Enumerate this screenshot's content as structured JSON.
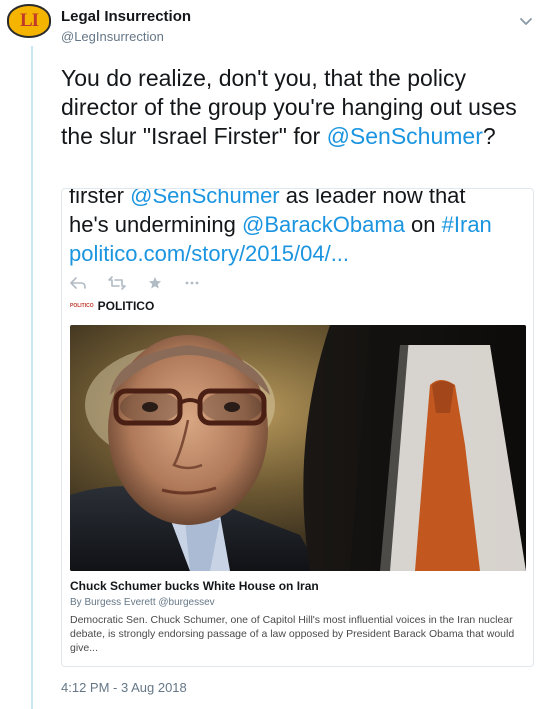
{
  "account": {
    "logo_text": "LI",
    "name": "Legal Insurrection",
    "handle": "@LegInsurrection"
  },
  "tweet": {
    "text_part1": "You do realize, don't you, that the policy director of the group you're hanging out uses the slur \"Israel Firster\" for ",
    "mention": "@SenSchumer",
    "text_part2": "?",
    "timestamp": "4:12 PM - 3 Aug 2018"
  },
  "quoted": {
    "line1_word": "firster ",
    "line1_mention": "@SenSchumer",
    "line1_rest": " as leader now that",
    "line2_pre": "he's undermining ",
    "line2_mention": "@BarackObama",
    "line2_mid": " on ",
    "line2_hashtag": "#Iran",
    "line3_link": "politico.com/story/2015/04/...",
    "actions": [
      "reply-icon",
      "retweet-icon",
      "like-icon",
      "more-icon"
    ]
  },
  "card": {
    "source_tiny": "POLITICO",
    "source": "POLITICO",
    "title": "Chuck Schumer bucks White House on Iran",
    "byline": "By Burgess Everett @burgessev",
    "description": "Democratic Sen. Chuck Schumer, one of Capitol Hill's most influential voices in the Iran nuclear debate, is strongly endorsing passage of a law opposed by President Barack Obama that would give..."
  },
  "colors": {
    "link": "#1b95e0",
    "thread_line": "#c9e6f4",
    "logo_bg": "#f5b400",
    "logo_text": "#c0392b"
  }
}
